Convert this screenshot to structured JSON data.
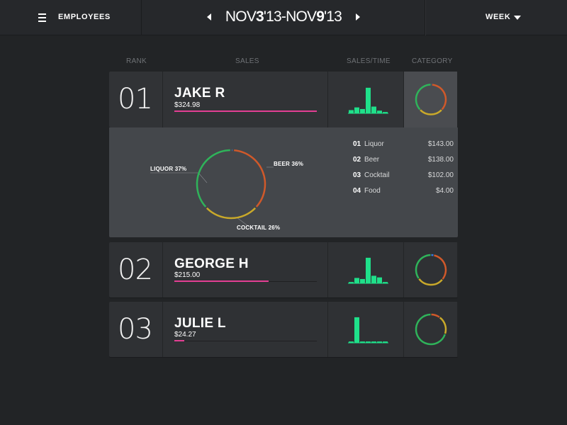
{
  "header": {
    "menu_label": "EMPLOYEES",
    "date_start_prefix": "NOV",
    "date_start_day": "3",
    "date_start_suffix": "'13-",
    "date_end_prefix": "NOV",
    "date_end_day": "9",
    "date_end_suffix": "'13",
    "period_label": "WEEK"
  },
  "columns": {
    "rank": "RANK",
    "sales": "SALES",
    "sales_time": "SALES/TIME",
    "category": "CATEGORY"
  },
  "colors": {
    "accent_pink": "#e33f93",
    "bar_green": "#1fe08a",
    "liquor": "#2fb35a",
    "beer": "#d0592a",
    "cocktail": "#c9a92a",
    "food": "#3a7be0"
  },
  "employees": [
    {
      "rank": "01",
      "name": "JAKE R",
      "sales": "$324.98",
      "sales_fraction": 1.0,
      "sales_time": [
        0.12,
        0.22,
        0.16,
        0.95,
        0.25,
        0.1,
        0.05
      ],
      "category_share": {
        "liquor": 37,
        "beer": 36,
        "cocktail": 26,
        "food": 1
      }
    },
    {
      "rank": "02",
      "name": "GEORGE H",
      "sales": "$215.00",
      "sales_fraction": 0.66,
      "sales_time": [
        0.05,
        0.2,
        0.16,
        0.95,
        0.28,
        0.22,
        0.05
      ],
      "category_share": {
        "liquor": 35,
        "beer": 33,
        "cocktail": 29,
        "food": 3
      }
    },
    {
      "rank": "03",
      "name": "JULIE L",
      "sales": "$24.27",
      "sales_fraction": 0.07,
      "sales_time": [
        0.05,
        0.95,
        0.05,
        0.05,
        0.05,
        0.05,
        0.05
      ],
      "category_share": {
        "liquor": 70,
        "beer": 10,
        "cocktail": 20,
        "food": 0
      }
    }
  ],
  "detail": {
    "labels": {
      "liquor": "LIQUOR 37%",
      "beer": "BEER 36%",
      "cocktail": "COCKTAIL 26%"
    },
    "breakdown": [
      {
        "idx": "01",
        "label": "Liquor",
        "value": "$143.00"
      },
      {
        "idx": "02",
        "label": "Beer",
        "value": "$138.00"
      },
      {
        "idx": "03",
        "label": "Cocktail",
        "value": "$102.00"
      },
      {
        "idx": "04",
        "label": "Food",
        "value": "$4.00"
      }
    ]
  }
}
